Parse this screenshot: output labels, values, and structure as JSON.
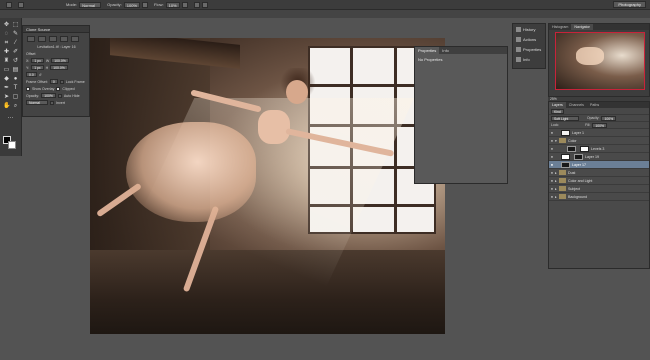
{
  "optbar": {
    "mode_label": "Mode:",
    "mode_value": "Normal",
    "opacity_label": "Opacity:",
    "opacity_value": "100%",
    "flow_label": "Flow:",
    "flow_value": "10%",
    "workspace": "Photography"
  },
  "clone_source": {
    "title": "Clone Source",
    "source_name": "Levitation1.tif : Layer 16",
    "offset_label": "Offset",
    "x_label": "X:",
    "x_value": "1 px",
    "y_label": "Y:",
    "y_value": "1 px",
    "w_value": "100.0%",
    "h_value": "100.0%",
    "angle_value": "0.0",
    "frame_offset_label": "Frame Offset:",
    "frame_offset_value": "0",
    "lock_frame": "Lock Frame",
    "show_overlay": "Show Overlay",
    "clipped": "Clipped",
    "overlay_opacity_label": "Opacity:",
    "overlay_opacity_value": "100%",
    "auto_hide": "Auto Hide",
    "blend_mode": "Normal",
    "invert": "Invert"
  },
  "properties": {
    "tab_properties": "Properties",
    "tab_info": "Info",
    "no_properties": "No Properties"
  },
  "dock": {
    "items": [
      {
        "label": "History"
      },
      {
        "label": "Actions"
      },
      {
        "label": "Properties"
      },
      {
        "label": "Info"
      }
    ]
  },
  "navigator": {
    "tab_histogram": "Histogram",
    "tab_navigator": "Navigator",
    "zoom": "25%"
  },
  "layers": {
    "tab_layers": "Layers",
    "tab_channels": "Channels",
    "tab_paths": "Paths",
    "filter_kind": "Kind",
    "blend_mode": "Soft Light",
    "opacity_label": "Opacity:",
    "opacity_value": "100%",
    "lock_label": "Lock:",
    "fill_label": "Fill:",
    "fill_value": "100%",
    "items": [
      {
        "name": "Layer 1"
      },
      {
        "name": "Color"
      },
      {
        "name": "Levels 3"
      },
      {
        "name": "Layer 19"
      },
      {
        "name": "Layer 17"
      },
      {
        "name": "Dust"
      },
      {
        "name": "Color and Light"
      },
      {
        "name": "Subject"
      },
      {
        "name": "Background"
      }
    ]
  }
}
